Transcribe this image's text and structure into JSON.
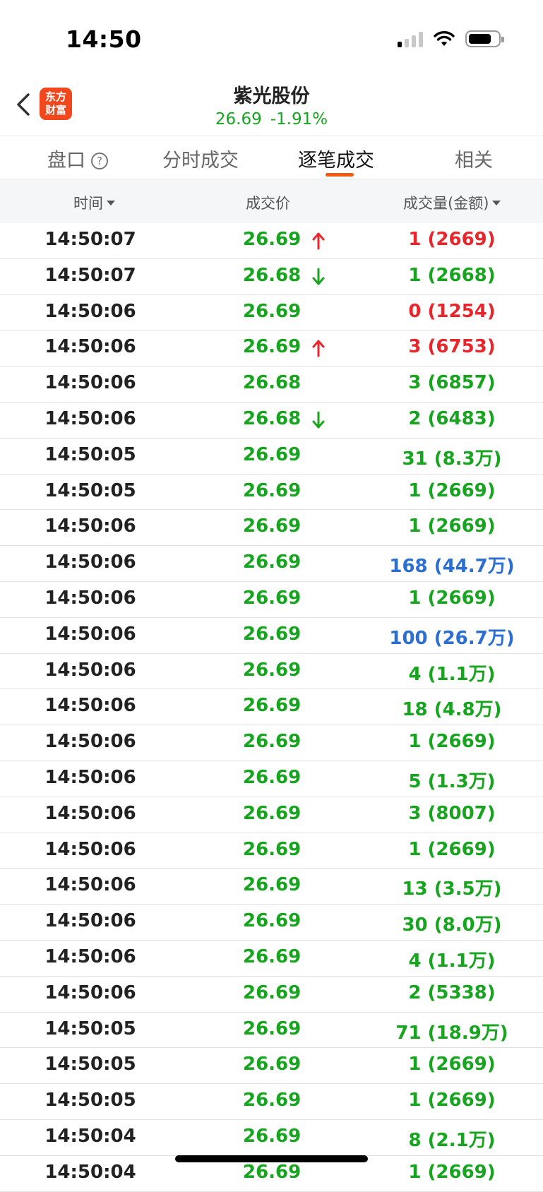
{
  "status_bar": {
    "time": "14:50"
  },
  "header": {
    "logo_line1": "东方",
    "logo_line2": "财富",
    "title": "紫光股份",
    "price": "26.69",
    "change": "-1.91%"
  },
  "tabs": [
    {
      "label": "盘口"
    },
    {
      "label": "分时成交"
    },
    {
      "label": "逐笔成交"
    },
    {
      "label": "相关"
    }
  ],
  "columns": {
    "time": "时间",
    "price": "成交价",
    "volume": "成交量(金额)"
  },
  "colors": {
    "up": "#e8262b",
    "down": "#17a51f",
    "large": "#2a6fd1",
    "accent": "#ef5a14"
  },
  "rows": [
    {
      "time": "14:50:07",
      "price": "26.69",
      "arrow": "up",
      "volume": "1 (2669)",
      "vol_color": "red"
    },
    {
      "time": "14:50:07",
      "price": "26.68",
      "arrow": "down",
      "volume": "1 (2668)",
      "vol_color": "green"
    },
    {
      "time": "14:50:06",
      "price": "26.69",
      "arrow": "",
      "volume": "0 (1254)",
      "vol_color": "red"
    },
    {
      "time": "14:50:06",
      "price": "26.69",
      "arrow": "up",
      "volume": "3 (6753)",
      "vol_color": "red"
    },
    {
      "time": "14:50:06",
      "price": "26.68",
      "arrow": "",
      "volume": "3 (6857)",
      "vol_color": "green"
    },
    {
      "time": "14:50:06",
      "price": "26.68",
      "arrow": "down",
      "volume": "2 (6483)",
      "vol_color": "green"
    },
    {
      "time": "14:50:05",
      "price": "26.69",
      "arrow": "",
      "volume": "31 (8.3万)",
      "vol_color": "green"
    },
    {
      "time": "14:50:05",
      "price": "26.69",
      "arrow": "",
      "volume": "1 (2669)",
      "vol_color": "green"
    },
    {
      "time": "14:50:06",
      "price": "26.69",
      "arrow": "",
      "volume": "1 (2669)",
      "vol_color": "green"
    },
    {
      "time": "14:50:06",
      "price": "26.69",
      "arrow": "",
      "volume": "168 (44.7万)",
      "vol_color": "blue"
    },
    {
      "time": "14:50:06",
      "price": "26.69",
      "arrow": "",
      "volume": "1 (2669)",
      "vol_color": "green"
    },
    {
      "time": "14:50:06",
      "price": "26.69",
      "arrow": "",
      "volume": "100 (26.7万)",
      "vol_color": "blue"
    },
    {
      "time": "14:50:06",
      "price": "26.69",
      "arrow": "",
      "volume": "4 (1.1万)",
      "vol_color": "green"
    },
    {
      "time": "14:50:06",
      "price": "26.69",
      "arrow": "",
      "volume": "18 (4.8万)",
      "vol_color": "green"
    },
    {
      "time": "14:50:06",
      "price": "26.69",
      "arrow": "",
      "volume": "1 (2669)",
      "vol_color": "green"
    },
    {
      "time": "14:50:06",
      "price": "26.69",
      "arrow": "",
      "volume": "5 (1.3万)",
      "vol_color": "green"
    },
    {
      "time": "14:50:06",
      "price": "26.69",
      "arrow": "",
      "volume": "3 (8007)",
      "vol_color": "green"
    },
    {
      "time": "14:50:06",
      "price": "26.69",
      "arrow": "",
      "volume": "1 (2669)",
      "vol_color": "green"
    },
    {
      "time": "14:50:06",
      "price": "26.69",
      "arrow": "",
      "volume": "13 (3.5万)",
      "vol_color": "green"
    },
    {
      "time": "14:50:06",
      "price": "26.69",
      "arrow": "",
      "volume": "30 (8.0万)",
      "vol_color": "green"
    },
    {
      "time": "14:50:06",
      "price": "26.69",
      "arrow": "",
      "volume": "4 (1.1万)",
      "vol_color": "green"
    },
    {
      "time": "14:50:06",
      "price": "26.69",
      "arrow": "",
      "volume": "2 (5338)",
      "vol_color": "green"
    },
    {
      "time": "14:50:05",
      "price": "26.69",
      "arrow": "",
      "volume": "71 (18.9万)",
      "vol_color": "green"
    },
    {
      "time": "14:50:05",
      "price": "26.69",
      "arrow": "",
      "volume": "1 (2669)",
      "vol_color": "green"
    },
    {
      "time": "14:50:05",
      "price": "26.69",
      "arrow": "",
      "volume": "1 (2669)",
      "vol_color": "green"
    },
    {
      "time": "14:50:04",
      "price": "26.69",
      "arrow": "",
      "volume": "8 (2.1万)",
      "vol_color": "green"
    },
    {
      "time": "14:50:04",
      "price": "26.69",
      "arrow": "",
      "volume": "1 (2669)",
      "vol_color": "green"
    }
  ]
}
